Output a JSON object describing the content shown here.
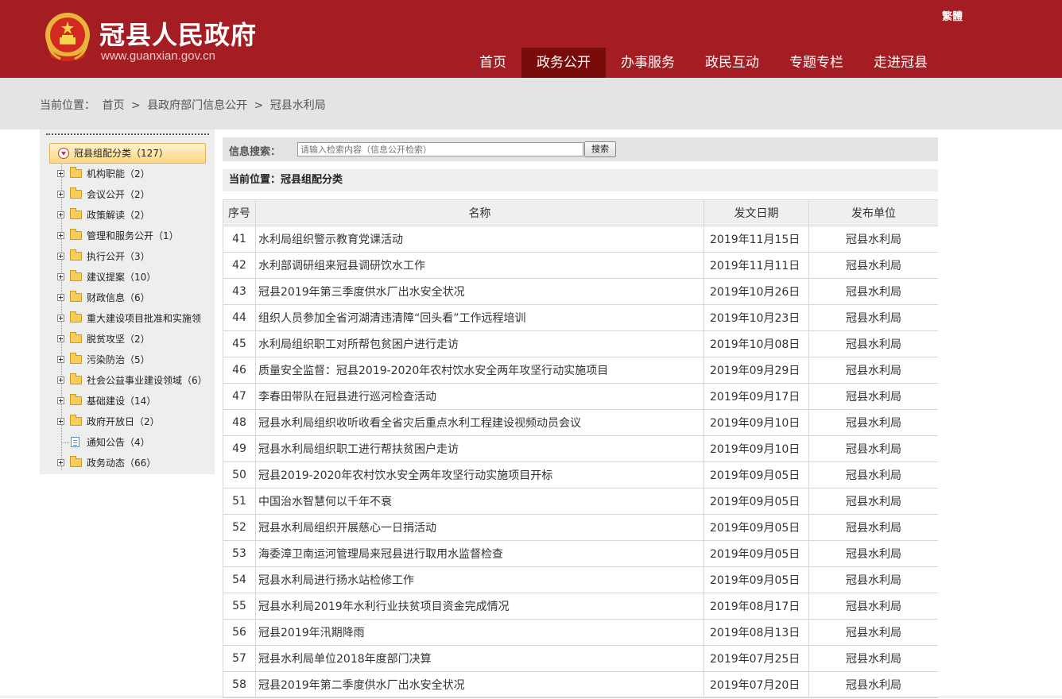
{
  "header": {
    "site_title": "冠县人民政府",
    "site_url": "www.guanxian.gov.cn",
    "traditional_link": "繁體",
    "nav": [
      {
        "label": "首页",
        "active": false
      },
      {
        "label": "政务公开",
        "active": true
      },
      {
        "label": "办事服务",
        "active": false
      },
      {
        "label": "政民互动",
        "active": false
      },
      {
        "label": "专题专栏",
        "active": false
      },
      {
        "label": "走进冠县",
        "active": false
      }
    ],
    "colors": {
      "brand": "#a31d23",
      "active_nav": "#7a0b0b"
    }
  },
  "breadcrumb": {
    "prefix": "当前位置：",
    "items": [
      "首页",
      "县政府部门信息公开",
      "冠县水利局"
    ],
    "separator": ">"
  },
  "sidebar": {
    "root": "冠县组配分类（127）",
    "items": [
      {
        "label": "机构职能（2）",
        "icon": "folder-icon"
      },
      {
        "label": "会议公开（2）",
        "icon": "folder-icon"
      },
      {
        "label": "政策解读（2）",
        "icon": "folder-icon"
      },
      {
        "label": "管理和服务公开（1）",
        "icon": "folder-icon"
      },
      {
        "label": "执行公开（3）",
        "icon": "folder-icon"
      },
      {
        "label": "建议提案（10）",
        "icon": "folder-icon"
      },
      {
        "label": "财政信息（6）",
        "icon": "folder-icon"
      },
      {
        "label": "重大建设项目批准和实施领",
        "icon": "folder-icon"
      },
      {
        "label": "脱贫攻坚（2）",
        "icon": "folder-icon"
      },
      {
        "label": "污染防治（5）",
        "icon": "folder-icon"
      },
      {
        "label": "社会公益事业建设领域（6）",
        "icon": "folder-icon"
      },
      {
        "label": "基础建设（14）",
        "icon": "folder-icon"
      },
      {
        "label": "政府开放日（2）",
        "icon": "folder-icon"
      },
      {
        "label": "通知公告（4）",
        "icon": "document-icon"
      },
      {
        "label": "政务动态（66）",
        "icon": "folder-icon"
      }
    ]
  },
  "search": {
    "label": "信息搜索：",
    "placeholder": "请输入检索内容（信息公开检索）",
    "button": "搜索"
  },
  "section_title": "当前位置：冠县组配分类",
  "table": {
    "headers": [
      "序号",
      "名称",
      "发文日期",
      "发布单位"
    ],
    "rows": [
      [
        "41",
        "水利局组织警示教育党课活动",
        "2019年11月15日",
        "冠县水利局"
      ],
      [
        "42",
        "水利部调研组来冠县调研饮水工作",
        "2019年11月11日",
        "冠县水利局"
      ],
      [
        "43",
        "冠县2019年第三季度供水厂出水安全状况",
        "2019年10月26日",
        "冠县水利局"
      ],
      [
        "44",
        "组织人员参加全省河湖清违清障“回头看”工作远程培训",
        "2019年10月23日",
        "冠县水利局"
      ],
      [
        "45",
        "水利局组织职工对所帮包贫困户进行走访",
        "2019年10月08日",
        "冠县水利局"
      ],
      [
        "46",
        "质量安全监督：冠县2019-2020年农村饮水安全两年攻坚行动实施项目",
        "2019年09月29日",
        "冠县水利局"
      ],
      [
        "47",
        "李春田带队在冠县进行巡河检查活动",
        "2019年09月17日",
        "冠县水利局"
      ],
      [
        "48",
        "冠县水利局组织收听收看全省灾后重点水利工程建设视频动员会议",
        "2019年09月10日",
        "冠县水利局"
      ],
      [
        "49",
        "冠县水利局组织职工进行帮扶贫困户走访",
        "2019年09月10日",
        "冠县水利局"
      ],
      [
        "50",
        "冠县2019-2020年农村饮水安全两年攻坚行动实施项目开标",
        "2019年09月05日",
        "冠县水利局"
      ],
      [
        "51",
        "中国治水智慧何以千年不衰",
        "2019年09月05日",
        "冠县水利局"
      ],
      [
        "52",
        "冠县水利局组织开展慈心一日捐活动",
        "2019年09月05日",
        "冠县水利局"
      ],
      [
        "53",
        "海委漳卫南运河管理局来冠县进行取用水监督检查",
        "2019年09月05日",
        "冠县水利局"
      ],
      [
        "54",
        "冠县水利局进行扬水站检修工作",
        "2019年09月05日",
        "冠县水利局"
      ],
      [
        "55",
        "冠县水利局2019年水利行业扶贫项目资金完成情况",
        "2019年08月17日",
        "冠县水利局"
      ],
      [
        "56",
        "冠县2019年汛期降雨",
        "2019年08月13日",
        "冠县水利局"
      ],
      [
        "57",
        "冠县水利局单位2018年度部门决算",
        "2019年07月25日",
        "冠县水利局"
      ],
      [
        "58",
        "冠县2019年第二季度供水厂出水安全状况",
        "2019年07月20日",
        "冠县水利局"
      ]
    ]
  }
}
